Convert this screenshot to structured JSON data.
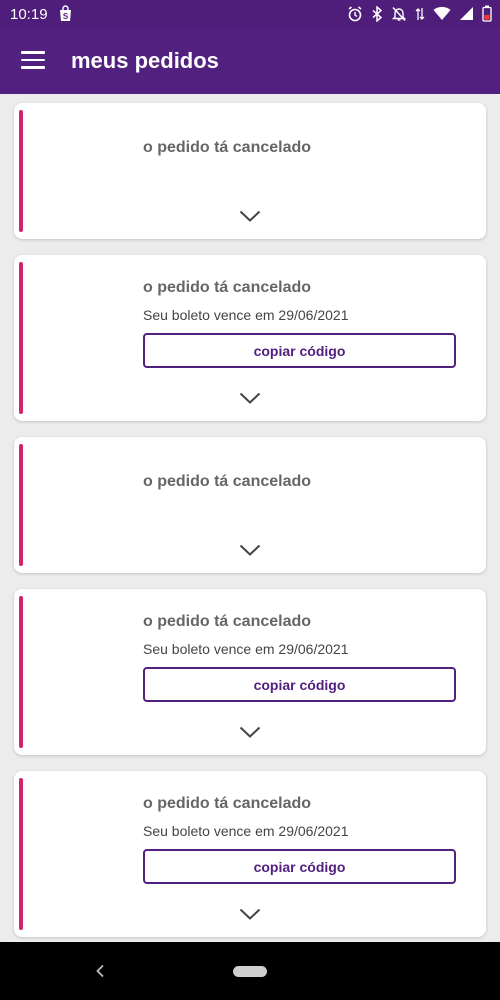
{
  "status_bar": {
    "time": "10:19",
    "icons": [
      "shopping-bag-icon",
      "alarm-icon",
      "bluetooth-icon",
      "notifications-off-icon",
      "data-arrows-icon",
      "wifi-icon",
      "signal-icon",
      "battery-low-icon"
    ]
  },
  "app_bar": {
    "title": "meus pedidos",
    "menu_icon": "hamburger-icon"
  },
  "orders": [
    {
      "status": "o pedido tá cancelado"
    },
    {
      "status": "o pedido tá cancelado",
      "due": "Seu boleto vence em 29/06/2021",
      "copy_label": "copiar código"
    },
    {
      "status": "o pedido tá cancelado"
    },
    {
      "status": "o pedido tá cancelado",
      "due": "Seu boleto vence em 29/06/2021",
      "copy_label": "copiar código"
    },
    {
      "status": "o pedido tá cancelado",
      "due": "Seu boleto vence em 29/06/2021",
      "copy_label": "copiar código"
    }
  ],
  "colors": {
    "primary": "#52207f",
    "status_bar": "#4f1d7a",
    "accent": "#d0246f",
    "background": "#ececec"
  },
  "nav_bar": {
    "icons": [
      "back-icon",
      "home-pill-icon"
    ]
  }
}
